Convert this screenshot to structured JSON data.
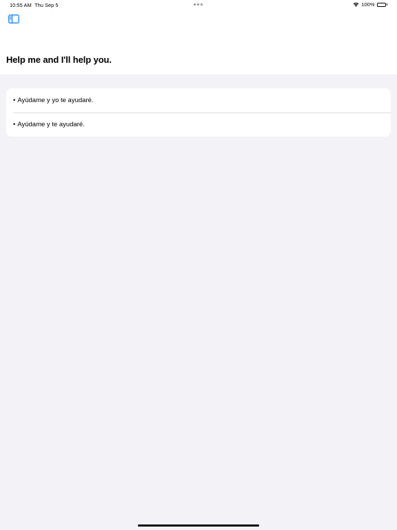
{
  "status_bar": {
    "time": "10:55 AM",
    "date": "Thu Sep 5",
    "battery_percent": "100%",
    "battery_level": 1.0
  },
  "nav": {
    "sidebar_toggle_icon": "sidebar-left-icon",
    "accent_color": "#007aff"
  },
  "header": {
    "title": "Help me and I'll help you."
  },
  "translations": {
    "bullet": "•",
    "items": [
      {
        "text": "Ayúdame y yo te ayudaré."
      },
      {
        "text": "Ayúdame y te ayudaré."
      }
    ]
  }
}
